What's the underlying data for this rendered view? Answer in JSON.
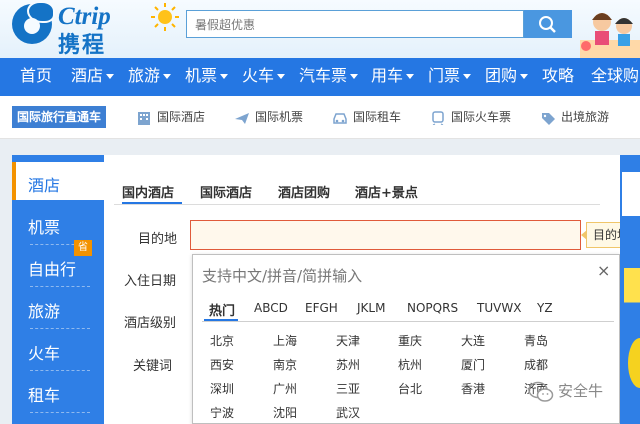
{
  "header": {
    "logo_en": "Ctrip",
    "logo_cn": "携程",
    "logo_icon": "dolphin-logo-icon",
    "search": {
      "value": "暑假超优惠",
      "button_icon": "search-icon"
    }
  },
  "nav": {
    "items": [
      {
        "label": "首页",
        "dropdown": false
      },
      {
        "label": "酒店",
        "dropdown": true
      },
      {
        "label": "旅游",
        "dropdown": true
      },
      {
        "label": "机票",
        "dropdown": true
      },
      {
        "label": "火车",
        "dropdown": true
      },
      {
        "label": "汽车票",
        "dropdown": true
      },
      {
        "label": "用车",
        "dropdown": true
      },
      {
        "label": "门票",
        "dropdown": true
      },
      {
        "label": "团购",
        "dropdown": true
      },
      {
        "label": "攻略",
        "dropdown": false
      },
      {
        "label": "全球购",
        "dropdown": false
      }
    ]
  },
  "subnav": {
    "label": "国际旅行直通车",
    "items": [
      {
        "label": "国际酒店",
        "icon": "building-icon"
      },
      {
        "label": "国际机票",
        "icon": "plane-icon"
      },
      {
        "label": "国际租车",
        "icon": "car-icon"
      },
      {
        "label": "国际火车票",
        "icon": "train-icon"
      },
      {
        "label": "出境旅游",
        "icon": "tag-icon"
      }
    ]
  },
  "left_menu": {
    "items": [
      "酒店",
      "机票",
      "自由行",
      "旅游",
      "火车",
      "租车"
    ],
    "badge": "省",
    "active": "酒店"
  },
  "hotel_form": {
    "tabs": [
      "国内酒店",
      "国际酒店",
      "酒店团购",
      "酒店+景点"
    ],
    "active_tab": "国内酒店",
    "labels": {
      "destination": "目的地",
      "checkin": "入住日期",
      "level": "酒店级别",
      "keyword": "关键词"
    },
    "tooltip": "目的地不能为空"
  },
  "city_dropdown": {
    "hint": "支持中文/拼音/简拼输入",
    "close": "×",
    "letter_tabs": [
      "热门",
      "ABCD",
      "EFGH",
      "JKLM",
      "NOPQRS",
      "TUVWX",
      "YZ"
    ],
    "active_letter_tab": "热门",
    "cities": [
      [
        "北京",
        "上海",
        "天津",
        "重庆",
        "大连",
        "青岛"
      ],
      [
        "西安",
        "南京",
        "苏州",
        "杭州",
        "厦门",
        "成都"
      ],
      [
        "深圳",
        "广州",
        "三亚",
        "台北",
        "香港",
        "济南"
      ],
      [
        "宁波",
        "沈阳",
        "武汉"
      ]
    ]
  },
  "watermark": {
    "text": "安全牛",
    "icon": "wechat-icon"
  },
  "colors": {
    "brand_blue": "#2577e3",
    "menu_blue": "#2f7fe6",
    "accent_orange": "#f39200",
    "error_border": "#e05a3a"
  }
}
